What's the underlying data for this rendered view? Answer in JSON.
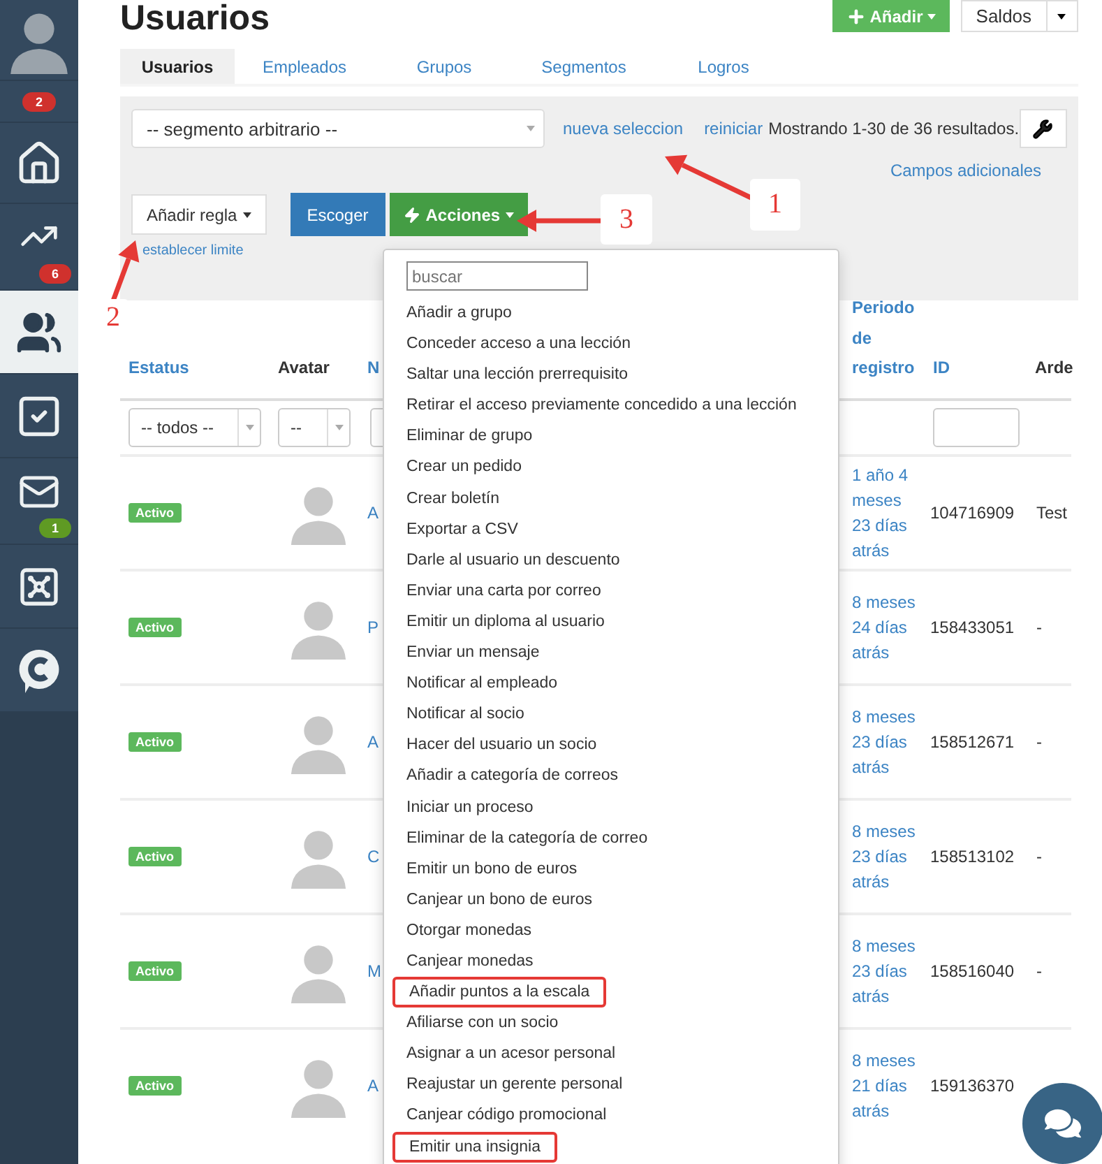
{
  "sidebar": {
    "items": [
      {
        "kind": "avatar",
        "selected": false
      },
      {
        "kind": "counter",
        "badge": "2",
        "color": "#d0312d",
        "selected": false
      },
      {
        "kind": "home",
        "selected": false
      },
      {
        "kind": "stats",
        "badge": "6",
        "color": "#d0312d",
        "selected": false
      },
      {
        "kind": "users",
        "selected": true
      },
      {
        "kind": "tasks",
        "selected": false
      },
      {
        "kind": "mail",
        "badge": "1",
        "color": "#5f9a23",
        "selected": false
      },
      {
        "kind": "safe",
        "selected": false
      },
      {
        "kind": "chat",
        "selected": false
      }
    ]
  },
  "header": {
    "title": "Usuarios",
    "add_button": "Añadir",
    "balance_button": "Saldos"
  },
  "tabs": [
    {
      "label": "Usuarios",
      "selected": true
    },
    {
      "label": "Empleados",
      "selected": false
    },
    {
      "label": "Grupos",
      "selected": false
    },
    {
      "label": "Segmentos",
      "selected": false
    },
    {
      "label": "Logros",
      "selected": false
    }
  ],
  "filter": {
    "segment_select": "-- segmento arbitrario --",
    "new_selection_link": "nueva seleccion",
    "reset_link": "reiniciar",
    "results_text": "Mostrando 1-30 de 36 resultados.",
    "extra_fields_link": "Campos adicionales",
    "add_rule_button": "Añadir regla",
    "choose_button": "Escoger",
    "actions_button": "Acciones",
    "limit_link": "establecer limite"
  },
  "table": {
    "columns": [
      {
        "label": "Estatus",
        "kind": "link"
      },
      {
        "label": "Avatar",
        "kind": "plain"
      },
      {
        "label": "N",
        "kind": "link"
      },
      {
        "label": "Periodo de registro",
        "kind": "link"
      },
      {
        "label": "ID",
        "kind": "link"
      },
      {
        "label": "Arde",
        "kind": "plain"
      }
    ],
    "filters": {
      "status": "-- todos --",
      "avatar": "--"
    },
    "rows": [
      {
        "status": "Activo",
        "name": "A",
        "registered": "1 año 4 meses 23 días atrás",
        "id": "104716909",
        "column_6": "Test"
      },
      {
        "status": "Activo",
        "name": "P",
        "registered": "8 meses 24 días atrás",
        "id": "158433051",
        "column_6": "-"
      },
      {
        "status": "Activo",
        "name": "A",
        "registered": "8 meses 23 días atrás",
        "id": "158512671",
        "column_6": "-"
      },
      {
        "status": "Activo",
        "name": "C",
        "registered": "8 meses 23 días atrás",
        "id": "158513102",
        "column_6": "-"
      },
      {
        "status": "Activo",
        "name": "M",
        "registered": "8 meses 23 días atrás",
        "id": "158516040",
        "column_6": "-"
      },
      {
        "status": "Activo",
        "name": "A",
        "registered": "8 meses 21 días atrás",
        "id": "159136370"
      }
    ]
  },
  "menu": {
    "search_placeholder": "buscar",
    "items": [
      {
        "label": "Añadir a grupo",
        "highlighted": false
      },
      {
        "label": "Conceder acceso a una lección",
        "highlighted": false
      },
      {
        "label": "Saltar una lección prerrequisito",
        "highlighted": false
      },
      {
        "label": "Retirar el acceso previamente concedido a una lección",
        "highlighted": false
      },
      {
        "label": "Eliminar de grupo",
        "highlighted": false
      },
      {
        "label": "Crear un pedido",
        "highlighted": false
      },
      {
        "label": "Crear boletín",
        "highlighted": false
      },
      {
        "label": "Exportar a CSV",
        "highlighted": false
      },
      {
        "label": "Darle al usuario un descuento",
        "highlighted": false
      },
      {
        "label": "Enviar una carta por correo",
        "highlighted": false
      },
      {
        "label": "Emitir un diploma al usuario",
        "highlighted": false
      },
      {
        "label": "Enviar un mensaje",
        "highlighted": false
      },
      {
        "label": "Notificar al empleado",
        "highlighted": false
      },
      {
        "label": "Notificar al socio",
        "highlighted": false
      },
      {
        "label": "Hacer del usuario un socio",
        "highlighted": false
      },
      {
        "label": "Añadir a categoría de correos",
        "highlighted": false
      },
      {
        "label": "Iniciar un proceso",
        "highlighted": false
      },
      {
        "label": "Eliminar de la categoría de correo",
        "highlighted": false
      },
      {
        "label": "Emitir un bono de euros",
        "highlighted": false
      },
      {
        "label": "Canjear un bono de euros",
        "highlighted": false
      },
      {
        "label": "Otorgar monedas",
        "highlighted": false
      },
      {
        "label": "Canjear monedas",
        "highlighted": false
      },
      {
        "label": "Añadir puntos a la escala",
        "highlighted": true
      },
      {
        "label": "Afiliarse con un socio",
        "highlighted": false
      },
      {
        "label": "Asignar a un acesor personal",
        "highlighted": false
      },
      {
        "label": "Reajustar un gerente personal",
        "highlighted": false
      },
      {
        "label": "Canjear código promocional",
        "highlighted": false
      },
      {
        "label": "Emitir una insignia",
        "highlighted": true
      }
    ]
  },
  "annotations": [
    {
      "label": "1"
    },
    {
      "label": "2"
    },
    {
      "label": "3"
    }
  ]
}
